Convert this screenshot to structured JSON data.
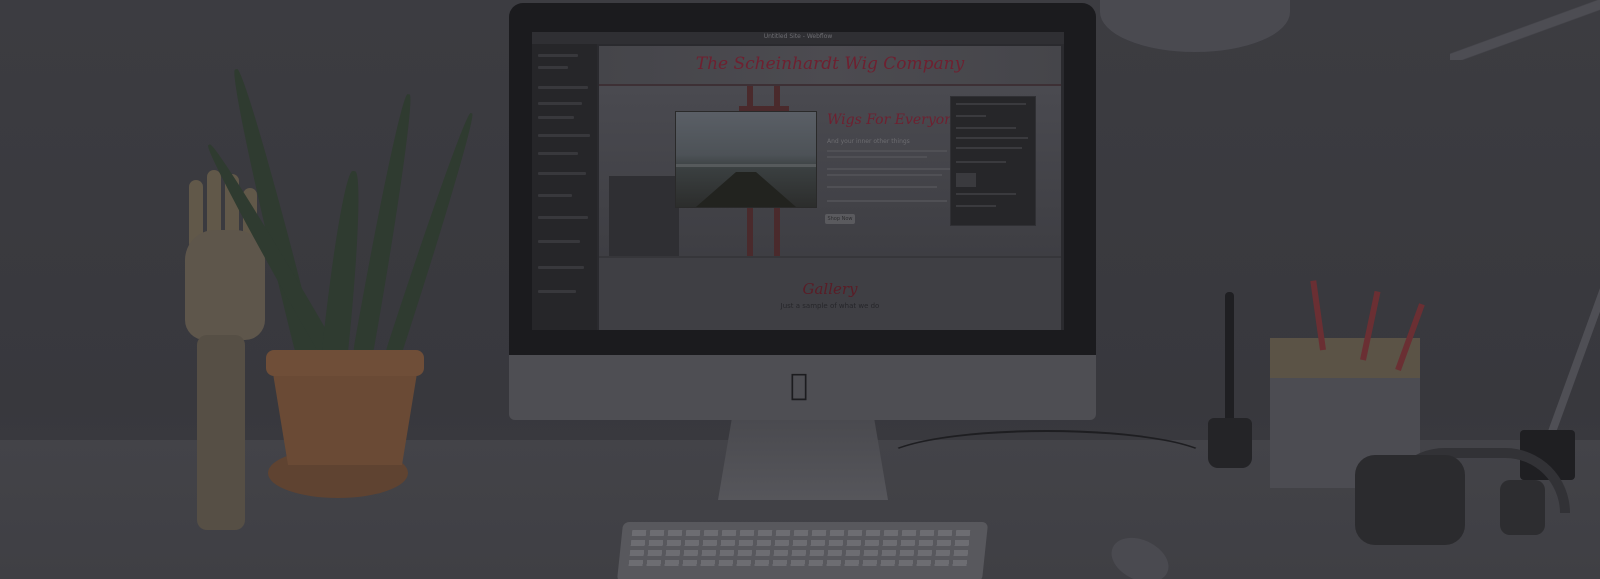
{
  "scene": {
    "description_colors": {
      "accent": "#6e2030",
      "backdrop": "#3a3a3f"
    }
  },
  "screen": {
    "editor_title": "Untitled Site - Webflow",
    "site": {
      "header_title": "The Scheinhardt Wig Company",
      "hero_heading": "Wigs For Everyone",
      "hero_subheading": "And your inner other things",
      "hero_button": "Shop Now",
      "gallery_title": "Gallery",
      "gallery_subtitle": "Just a sample of what we do"
    }
  },
  "icons": {
    "apple": "apple-logo-icon"
  }
}
